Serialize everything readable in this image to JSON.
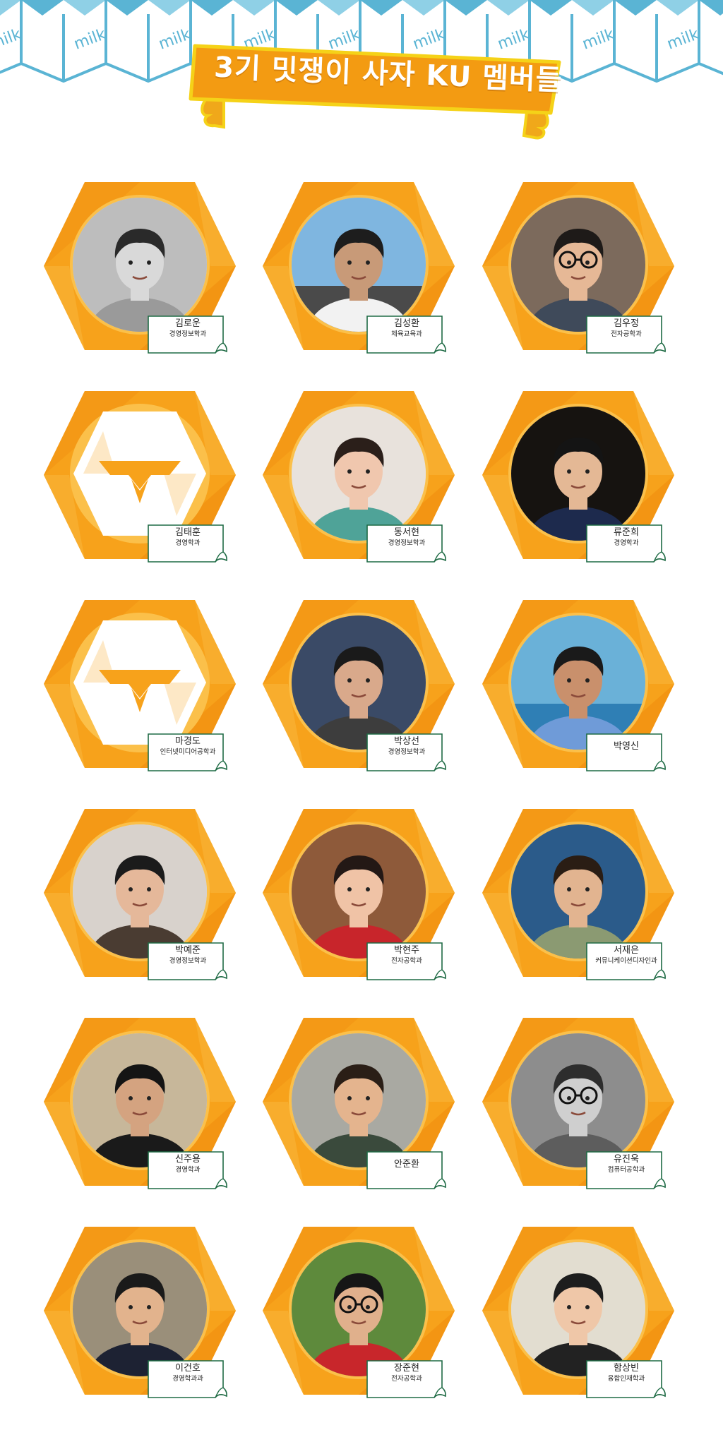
{
  "header": {
    "title": "3기 밋쟁이 사자 KU 멤버들",
    "carton_text": "milk"
  },
  "colors": {
    "hex_orange": "#f7a21b",
    "hex_dark": "#f08d0f",
    "carton_blue": "#5ab4d4",
    "banner_orange": "#f39b12",
    "tag_border": "#1f6b45"
  },
  "members": [
    {
      "name": "김로운",
      "major": "경영정보학과",
      "photo": "photo-bw-portrait"
    },
    {
      "name": "김성환",
      "major": "체육교육과",
      "photo": "photo-seaside"
    },
    {
      "name": "김우정",
      "major": "전자공학과",
      "photo": "photo-glasses"
    },
    {
      "name": "김태훈",
      "major": "경영학과",
      "photo": "lion-logo"
    },
    {
      "name": "동서현",
      "major": "경영정보학과",
      "photo": "photo-mirror-selfie"
    },
    {
      "name": "류준희",
      "major": "경영학과",
      "photo": "photo-night"
    },
    {
      "name": "마경도",
      "major": "인터넷미디어공학과",
      "photo": "lion-logo"
    },
    {
      "name": "박상선",
      "major": "경영정보학과",
      "photo": "photo-selfie"
    },
    {
      "name": "박영신",
      "major": "",
      "photo": "photo-waterfront"
    },
    {
      "name": "박예준",
      "major": "경영정보학과",
      "photo": "photo-close"
    },
    {
      "name": "박현주",
      "major": "전자공학과",
      "photo": "photo-hanbok"
    },
    {
      "name": "서재은",
      "major": "커뮤니케이션디자인과",
      "photo": "photo-ocean"
    },
    {
      "name": "신주용",
      "major": "경영학과",
      "photo": "photo-room"
    },
    {
      "name": "안준환",
      "major": "",
      "photo": "photo-city"
    },
    {
      "name": "유진욱",
      "major": "컴퓨터공학과",
      "photo": "photo-bw-glasses"
    },
    {
      "name": "이건호",
      "major": "경영학과과",
      "photo": "photo-suit"
    },
    {
      "name": "장준현",
      "major": "전자공학과",
      "photo": "photo-park"
    },
    {
      "name": "함상빈",
      "major": "융합인재학과",
      "photo": "photo-phone"
    }
  ]
}
